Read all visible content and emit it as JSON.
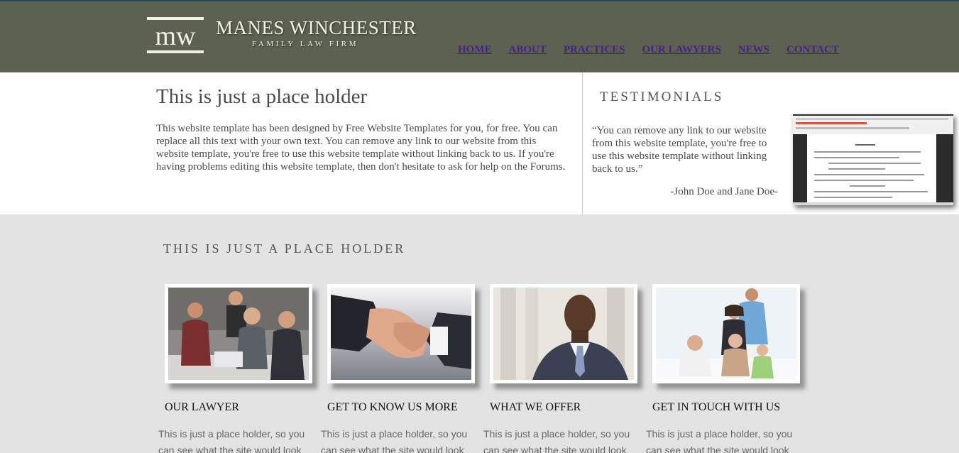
{
  "brand": {
    "name": "MANES WINCHESTER",
    "tagline": "FAMILY LAW FIRM",
    "logo_text": "MW"
  },
  "nav": [
    "HOME",
    "ABOUT",
    "PRACTICES",
    "OUR LAWYERS",
    "NEWS",
    "CONTACT"
  ],
  "intro": {
    "title": "This is just a place holder",
    "text": "This website template has been designed by Free Website Templates for you, for free. You can replace all this text with your own text. You can remove any link to our website from this website template, you're free to use this website template without linking back to us. If you're having problems editing this website template, then don't hesitate to ask for help on the Forums."
  },
  "testimonials": {
    "title": "TESTIMONIALS",
    "quote": "“You can remove any link to our website from this website template, you're free to use this website template without linking back to us.”",
    "author": "-John Doe and Jane Doe-"
  },
  "section": {
    "title": "THIS IS JUST A PLACE HOLDER",
    "cards": [
      {
        "title": "OUR LAWYER",
        "text": "This is just a place holder, so you can see what the site would look",
        "image": "meeting-photo"
      },
      {
        "title": "GET TO KNOW US MORE",
        "text": "This is just a place holder, so you can see what the site would look",
        "image": "handshake-photo"
      },
      {
        "title": "WHAT WE OFFER",
        "text": "This is just a place holder, so you can see what the site would look",
        "image": "businessman-photo"
      },
      {
        "title": "GET IN TOUCH WITH US",
        "text": "This is just a place holder, so you can see what the site would look",
        "image": "family-photo"
      }
    ]
  },
  "colors": {
    "header_bg": "#5c6151",
    "nav_link": "#48208a",
    "body_bg": "#e3e3e3"
  }
}
